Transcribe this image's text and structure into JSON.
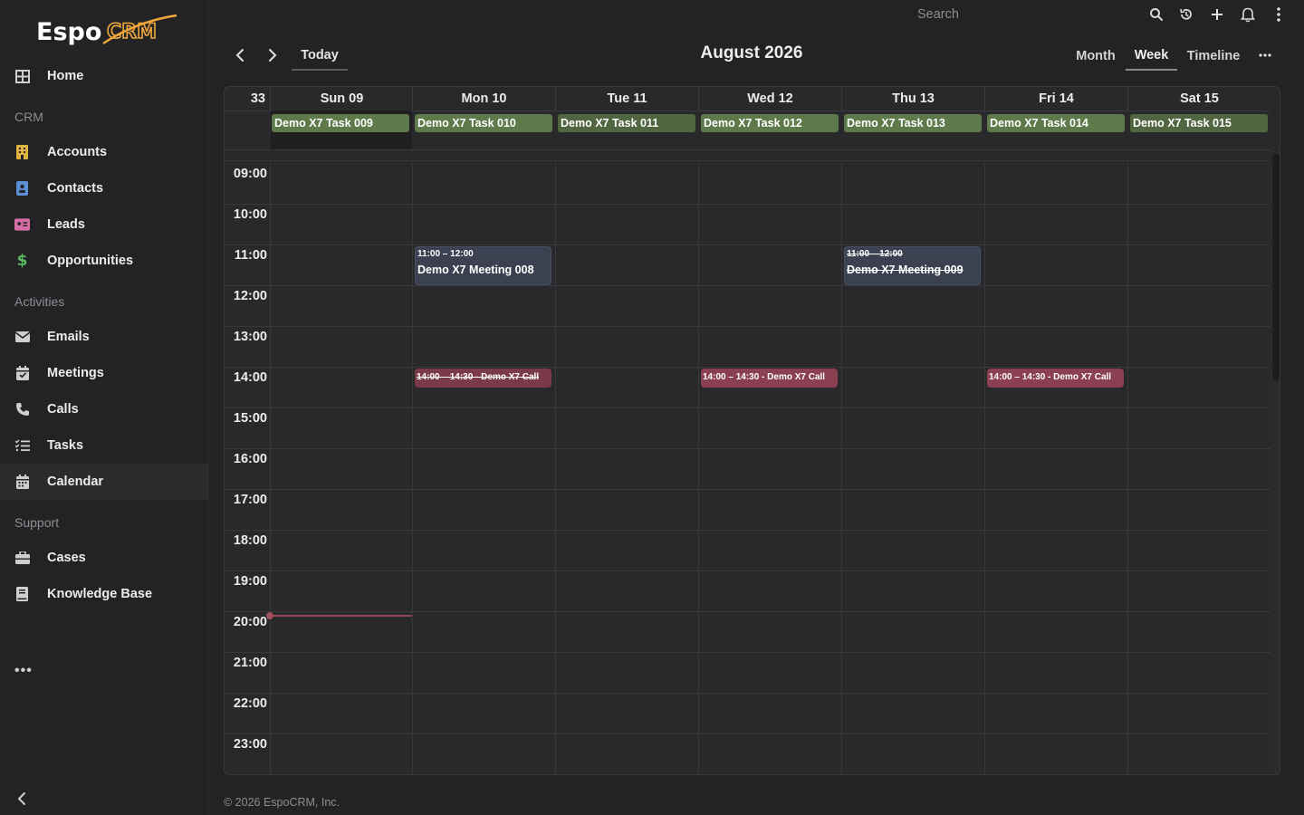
{
  "app": {
    "logo_text": "EspoCRM"
  },
  "sidebar": {
    "items": [
      {
        "label": "Home",
        "icon": "home-grid-icon"
      },
      {
        "label": "Accounts",
        "icon": "building-icon",
        "color": "#e0b340"
      },
      {
        "label": "Contacts",
        "icon": "contact-card-icon",
        "color": "#5b8fd6"
      },
      {
        "label": "Leads",
        "icon": "id-card-icon",
        "color": "#d86ea8"
      },
      {
        "label": "Opportunities",
        "icon": "dollar-icon",
        "color": "#5cb85c"
      },
      {
        "label": "Emails",
        "icon": "envelope-icon"
      },
      {
        "label": "Meetings",
        "icon": "calendar-check-icon"
      },
      {
        "label": "Calls",
        "icon": "phone-icon"
      },
      {
        "label": "Tasks",
        "icon": "task-list-icon"
      },
      {
        "label": "Calendar",
        "icon": "calendar-icon"
      },
      {
        "label": "Cases",
        "icon": "briefcase-icon"
      },
      {
        "label": "Knowledge Base",
        "icon": "book-icon"
      }
    ],
    "groups": {
      "crm": "CRM",
      "activities": "Activities",
      "support": "Support"
    },
    "more": "•••",
    "active_item": "Calendar"
  },
  "topbar": {
    "search_placeholder": "Search"
  },
  "calendar": {
    "today_label": "Today",
    "title": "August 2026",
    "views": [
      "Month",
      "Week",
      "Timeline"
    ],
    "active_view": "Week",
    "week_number": "33",
    "days": [
      "Sun 09",
      "Mon 10",
      "Tue 11",
      "Wed 12",
      "Thu 13",
      "Fri 14",
      "Sat 15"
    ],
    "tasks": [
      "Demo X7 Task 009",
      "Demo X7 Task 010",
      "Demo X7 Task 011",
      "Demo X7 Task 012",
      "Demo X7 Task 013",
      "Demo X7 Task 014",
      "Demo X7 Task 015"
    ],
    "hours": [
      "09:00",
      "10:00",
      "11:00",
      "12:00",
      "13:00",
      "14:00",
      "15:00",
      "16:00",
      "17:00",
      "18:00",
      "19:00",
      "20:00",
      "21:00",
      "22:00",
      "23:00"
    ],
    "meetings": [
      {
        "time": "11:00 – 12:00",
        "name": "Demo X7 Meeting 008",
        "day": "Mon 10",
        "completed": false
      },
      {
        "time": "11:00 – 12:00",
        "name": "Demo X7 Meeting 009",
        "day": "Thu 13",
        "completed": true
      }
    ],
    "calls": [
      {
        "label": "14:00 – 14:30 - Demo X7 Call",
        "day": "Mon 10",
        "completed": true
      },
      {
        "label": "14:00 – 14:30 - Demo X7 Call",
        "day": "Wed 12",
        "completed": false
      },
      {
        "label": "14:00 – 14:30 - Demo X7 Call",
        "day": "Fri 14",
        "completed": false
      }
    ],
    "current_time": "20:00"
  },
  "footer": {
    "copyright": "© 2026 EspoCRM, Inc."
  },
  "colors": {
    "accent": "#f2a93b",
    "task": "#5e7a4a",
    "call": "#8a3f52",
    "meeting": "#3b4150"
  }
}
